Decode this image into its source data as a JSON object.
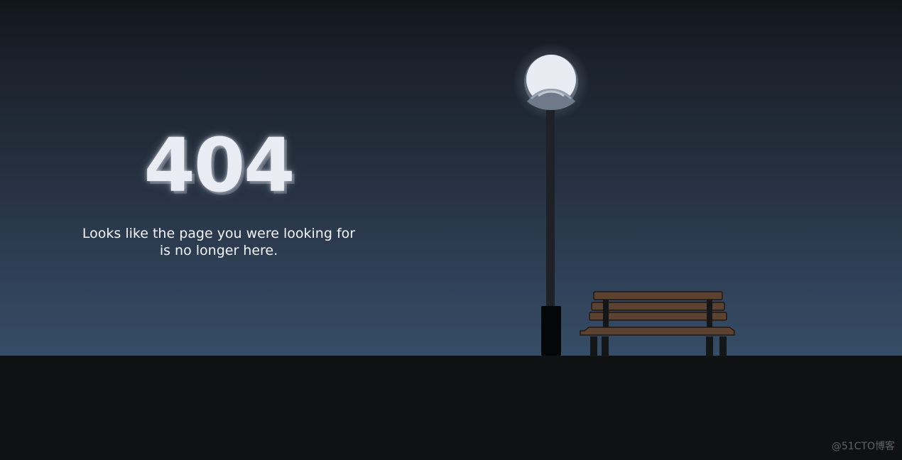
{
  "error": {
    "code": "404",
    "message_line1": "Looks like the page you were looking for",
    "message_line2": "is no longer here."
  },
  "watermark": "@51CTO博客",
  "colors": {
    "sky_top": "#11161c",
    "sky_bottom": "#364d67",
    "ground": "#0f1113",
    "text": "#f2f4f7",
    "lamp_light": "#e8ecf2",
    "bench_wood": "#5c4230"
  },
  "illustration": {
    "objects": [
      "street-lamp",
      "park-bench"
    ]
  }
}
